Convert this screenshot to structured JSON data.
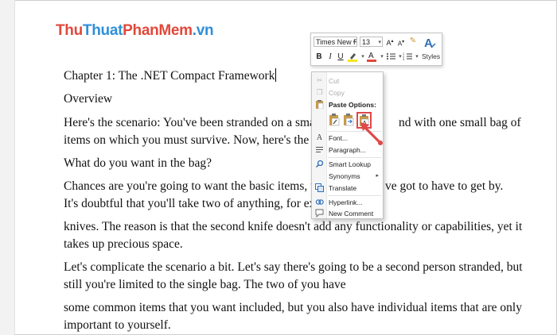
{
  "watermark": {
    "part1": "Thu",
    "part2": "Thuat",
    "part3": "PhanMem",
    "part4": ".vn"
  },
  "document": {
    "lines": [
      "Chapter 1: The .NET Compact Framework",
      "Overview",
      "Here's the scenario: You've been stranded on a sma",
      "items on which you must survive. Now, here's the qu",
      "What do you want in the bag?",
      "Chances are you're going to want the basic items, the",
      "It's doubtful that you'll take two of anything, for exam",
      "knives. The reason is that the second knife doesn't add any functionality or capabilities, yet it",
      "takes up precious space.",
      "Let's complicate the scenario a bit. Let's say there's going to be a second person stranded, but",
      "still you're limited to the single bag. The two of you have",
      "some common items that you want included, but you also have individual items that are only",
      "important to yourself."
    ],
    "right_fragments": {
      "line3": "nd with one small bag of",
      "line6": "ve got to have to get by."
    }
  },
  "mini_toolbar": {
    "font_name": "Times New Ro",
    "font_size": "13",
    "styles_label": "Styles",
    "buttons": [
      "grow-font",
      "shrink-font",
      "format-painter",
      "styles",
      "bold",
      "italic",
      "underline",
      "highlight",
      "font-color",
      "bullets",
      "numbering"
    ]
  },
  "context_menu": {
    "cut": "Cut",
    "copy": "Copy",
    "paste_options": "Paste Options:",
    "font": "Font...",
    "paragraph": "Paragraph...",
    "smart_lookup": "Smart Lookup",
    "synonyms": "Synonyms",
    "translate": "Translate",
    "hyperlink": "Hyperlink...",
    "new_comment": "New Comment"
  },
  "colors": {
    "highlight_border": "#e04848",
    "arrow": "#e04848",
    "accent_blue": "#2f8fd8"
  }
}
